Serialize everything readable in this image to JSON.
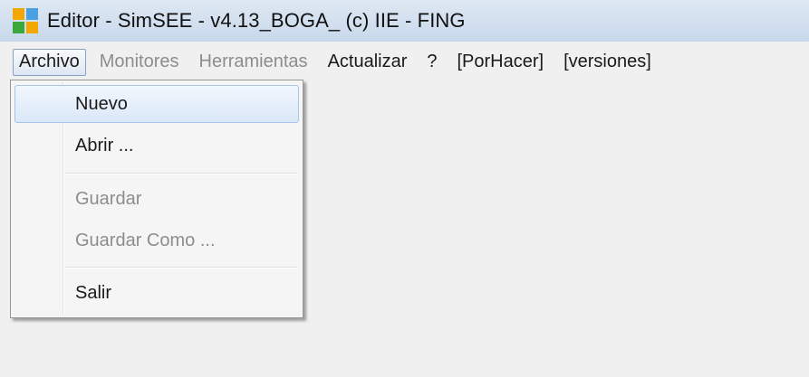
{
  "window": {
    "title": "Editor - SimSEE - v4.13_BOGA_ (c) IIE - FING",
    "icon": "simsee-app-icon"
  },
  "menubar": {
    "items": [
      {
        "label": "Archivo",
        "state": "active"
      },
      {
        "label": "Monitores",
        "state": "disabled"
      },
      {
        "label": "Herramientas",
        "state": "disabled"
      },
      {
        "label": "Actualizar",
        "state": "enabled"
      },
      {
        "label": "?",
        "state": "enabled"
      },
      {
        "label": "[PorHacer]",
        "state": "enabled"
      },
      {
        "label": "[versiones]",
        "state": "enabled"
      }
    ]
  },
  "archivo_menu": {
    "items": [
      {
        "label": "Nuevo",
        "state": "highlighted"
      },
      {
        "label": "Abrir ...",
        "state": "enabled"
      },
      {
        "label": "Guardar",
        "state": "disabled"
      },
      {
        "label": "Guardar Como ...",
        "state": "disabled"
      },
      {
        "label": "Salir",
        "state": "enabled"
      }
    ]
  }
}
